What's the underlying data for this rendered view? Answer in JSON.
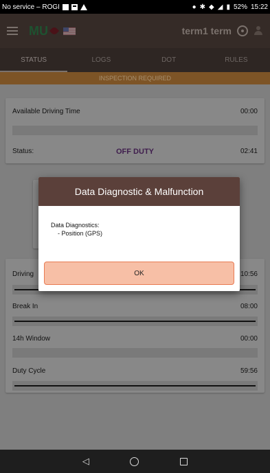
{
  "status_bar": {
    "carrier": "No service – ROGI",
    "battery": "52%",
    "time": "15:22"
  },
  "app_bar": {
    "menu_icon": "hamburger-menu-icon",
    "logo_text": "MU",
    "user_name": "term1 term",
    "wheel_icon": "steering-wheel-icon",
    "user_icon": "person-icon"
  },
  "tabs": [
    {
      "label": "STATUS",
      "active": true
    },
    {
      "label": "LOGS",
      "active": false
    },
    {
      "label": "DOT",
      "active": false
    },
    {
      "label": "RULES",
      "active": false
    }
  ],
  "banner": {
    "text": "INSPECTION REQUIRED",
    "color": "#7d5426"
  },
  "summary": {
    "available_label": "Available Driving Time",
    "available_value": "00:00",
    "status_label": "Status:",
    "status_value": "OFF DUTY",
    "status_time": "02:41"
  },
  "timers": [
    {
      "label": "Driving",
      "value": "10:56"
    },
    {
      "label": "Break In",
      "value": "08:00"
    },
    {
      "label": "14h Window",
      "value": "00:00"
    },
    {
      "label": "Duty Cycle",
      "value": "59:56"
    }
  ],
  "dialog": {
    "title": "Data Diagnostic & Malfunction",
    "heading": "Data Diagnostics:",
    "item": "- Position (GPS)",
    "ok_label": "OK"
  }
}
